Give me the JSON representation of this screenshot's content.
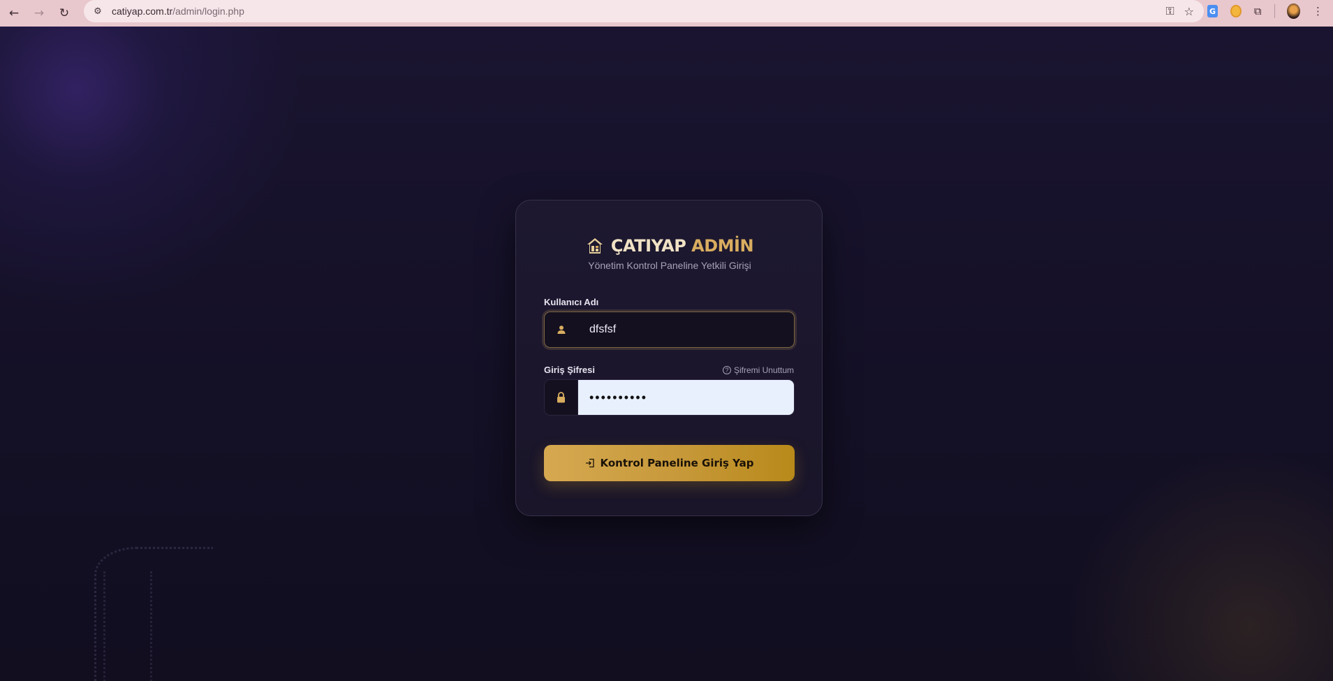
{
  "browser": {
    "url_host": "catiyap.com.tr",
    "url_path": "/admin/login.php"
  },
  "login": {
    "brand_part1": "ÇATIYAP",
    "brand_part2": "ADMİN",
    "subtitle": "Yönetim Kontrol Paneline Yetkili Girişi",
    "username_label": "Kullanıcı Adı",
    "username_value": "dfsfsf",
    "password_label": "Giriş Şifresi",
    "password_value": "••••••••••",
    "forgot_label": "Şifremi Unuttum",
    "submit_label": "Kontrol Paneline Giriş Yap"
  },
  "colors": {
    "accent_gold": "#d6a951",
    "background": "#140f24",
    "card": "#1d1830"
  }
}
